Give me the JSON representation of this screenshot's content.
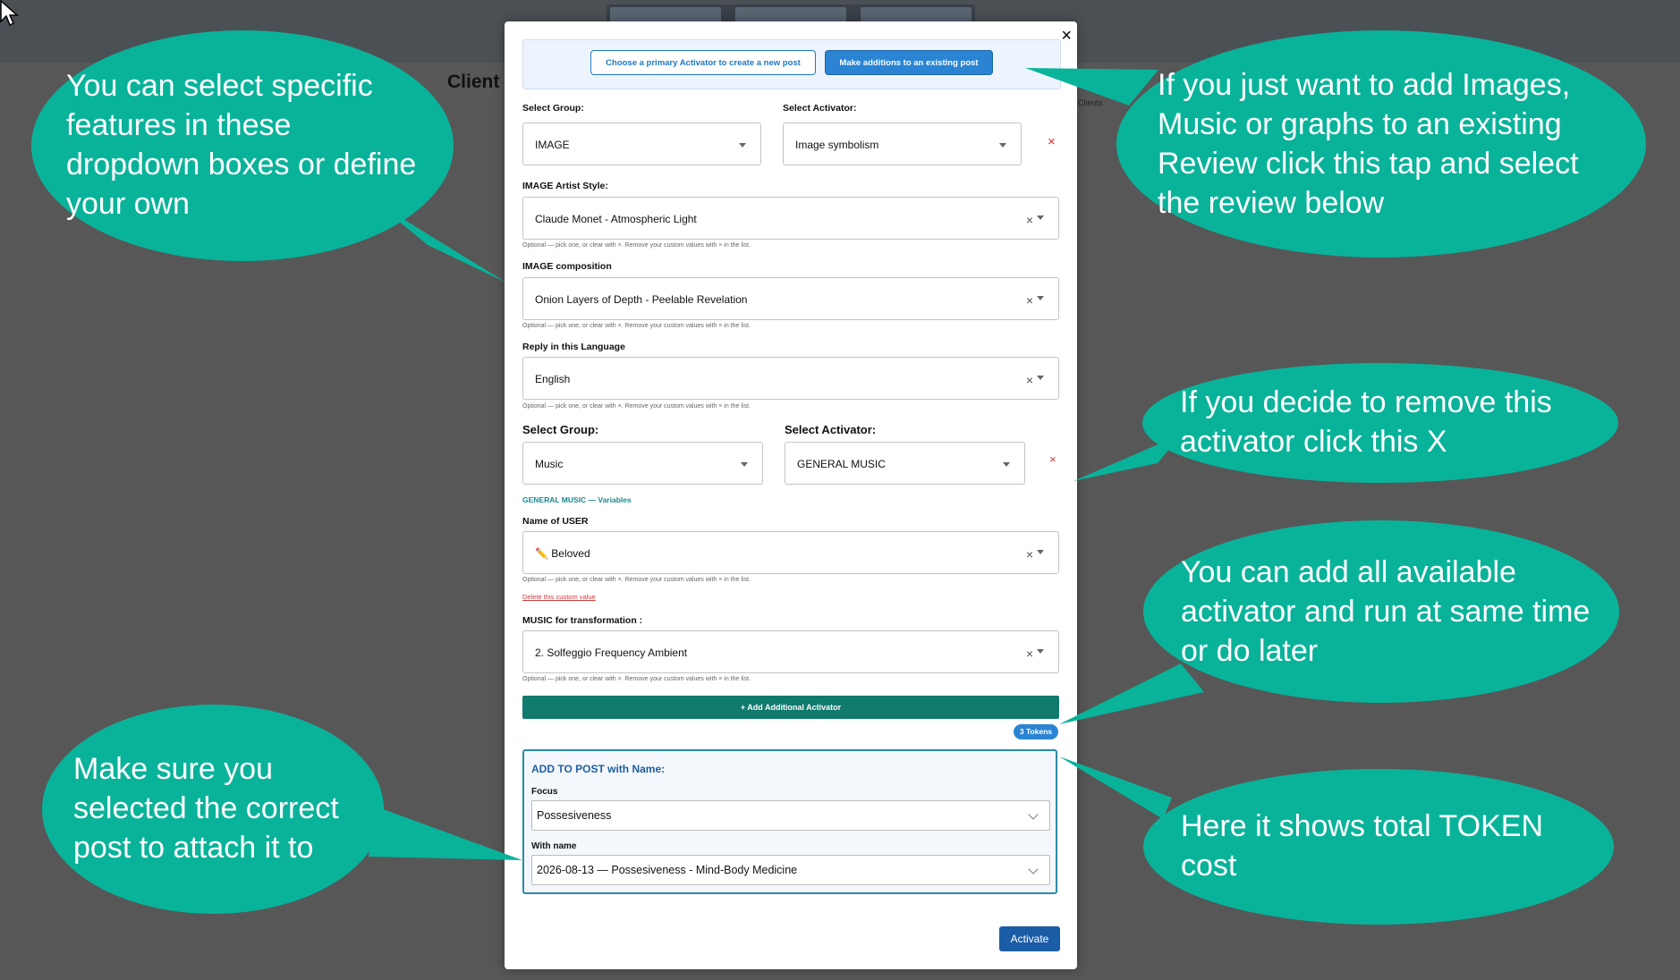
{
  "background": {
    "page_title": "Client",
    "clients_label": "Clients"
  },
  "modal": {
    "close_label": "×",
    "tabs": {
      "new_post": "Choose a primary Activator to create a new post",
      "existing_post": "Make additions to an existing post"
    },
    "activator1": {
      "group_label": "Select Group:",
      "group_value": "IMAGE",
      "activator_label": "Select Activator:",
      "activator_value": "Image symbolism",
      "remove": "×",
      "fields": [
        {
          "label": "IMAGE Artist Style:",
          "value": "Claude Monet - Atmospheric Light",
          "hint": "Optional — pick one, or clear with ×. Remove your custom values with × in the list."
        },
        {
          "label": "IMAGE composition",
          "value": "Onion Layers of Depth - Peelable Revelation",
          "hint": "Optional — pick one, or clear with ×. Remove your custom values with × in the list."
        },
        {
          "label": "Reply in this Language",
          "value": "English",
          "hint": "Optional — pick one, or clear with ×. Remove your custom values with × in the list."
        }
      ]
    },
    "activator2": {
      "group_label": "Select Group:",
      "group_value": "Music",
      "activator_label": "Select Activator:",
      "activator_value": "GENERAL MUSIC",
      "remove": "×",
      "section_label": "GENERAL MUSIC — Variables",
      "fields": [
        {
          "label": "Name of USER",
          "value": "✏️ Beloved",
          "hint": "Optional — pick one, or clear with ×. Remove your custom values with × in the list."
        },
        {
          "label": "MUSIC for transformation :",
          "value": "2. Solfeggio Frequency Ambient",
          "hint": "Optional — pick one, or clear with ×. Remove your custom values with × in the list."
        }
      ],
      "delete_custom": "Delete this custom value"
    },
    "add_activator_label": "+ Add Additional Activator",
    "tokens_label": "3 Tokens",
    "post": {
      "title": "ADD TO POST with Name:",
      "focus_label": "Focus",
      "focus_value": "Possesiveness",
      "name_label": "With name",
      "name_value": "2026-08-13 — Possesiveness - Mind-Body Medicine"
    },
    "activate_label": "Activate"
  },
  "callouts": {
    "dropdowns": "You can select specific features in these dropdown boxes or define your own",
    "existing_review": "If you just want to add Images, Music or graphs to an existing Review click this tap and select the review below",
    "remove_activator": "If you decide to remove this activator click this X",
    "add_all": "You can add all available activator and run at same time or do later",
    "correct_post": "Make sure you selected the correct post to attach it to",
    "token_cost": "Here it shows total TOKEN cost"
  },
  "colors": {
    "callout": "#09b39a",
    "primary_blue": "#2a84d3",
    "add_button": "#117a6e",
    "activate": "#1b5ca7",
    "remove_red": "#e03131"
  }
}
